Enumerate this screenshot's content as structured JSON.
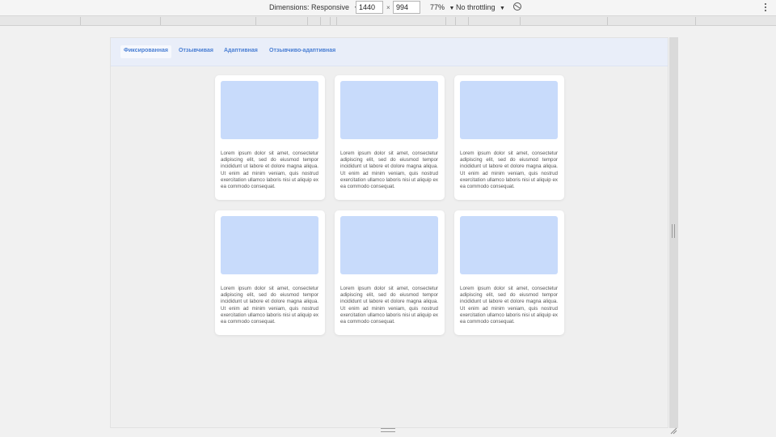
{
  "toolbar": {
    "dimensions_label": "Dimensions: Responsive",
    "width_value": "1440",
    "times_symbol": "×",
    "height_value": "994",
    "zoom_label": "77%",
    "throttle_label": "No throttling",
    "caret": "▼",
    "rotate_icon": "rotate-icon",
    "more_icon": "more-vertical-icon"
  },
  "nav": {
    "tabs": [
      {
        "label": "Фиксированная",
        "active": true
      },
      {
        "label": "Отзывчивая",
        "active": false
      },
      {
        "label": "Адаптивная",
        "active": false
      },
      {
        "label": "Отзывчиво-адаптивная",
        "active": false
      }
    ]
  },
  "cards": [
    {
      "text": "Lorem ipsum dolor sit amet, consectetur adipiscing elit, sed do eiusmod tempor incididunt ut labore et dolore magna aliqua. Ut enim ad minim veniam, quis nostrud exercitation ullamco laboris nisi ut aliquip ex ea commodo consequat."
    },
    {
      "text": "Lorem ipsum dolor sit amet, consectetur adipiscing elit, sed do eiusmod tempor incididunt ut labore et dolore magna aliqua. Ut enim ad minim veniam, quis nostrud exercitation ullamco laboris nisi ut aliquip ex ea commodo consequat."
    },
    {
      "text": "Lorem ipsum dolor sit amet, consectetur adipiscing elit, sed do eiusmod tempor incididunt ut labore et dolore magna aliqua. Ut enim ad minim veniam, quis nostrud exercitation ullamco laboris nisi ut aliquip ex ea commodo consequat."
    },
    {
      "text": "Lorem ipsum dolor sit amet, consectetur adipiscing elit, sed do eiusmod tempor incididunt ut labore et dolore magna aliqua. Ut enim ad minim veniam, quis nostrud exercitation ullamco laboris nisi ut aliquip ex ea commodo consequat."
    },
    {
      "text": "Lorem ipsum dolor sit amet, consectetur adipiscing elit, sed do eiusmod tempor incididunt ut labore et dolore magna aliqua. Ut enim ad minim veniam, quis nostrud exercitation ullamco laboris nisi ut aliquip ex ea commodo consequat."
    },
    {
      "text": "Lorem ipsum dolor sit amet, consectetur adipiscing elit, sed do eiusmod tempor incididunt ut labore et dolore magna aliqua. Ut enim ad minim veniam, quis nostrud exercitation ullamco laboris nisi ut aliquip ex ea commodo consequat."
    }
  ],
  "colors": {
    "accent": "#4a7fd4",
    "card_image": "#c8dbfb",
    "navbar_bg": "#e9eef9"
  }
}
